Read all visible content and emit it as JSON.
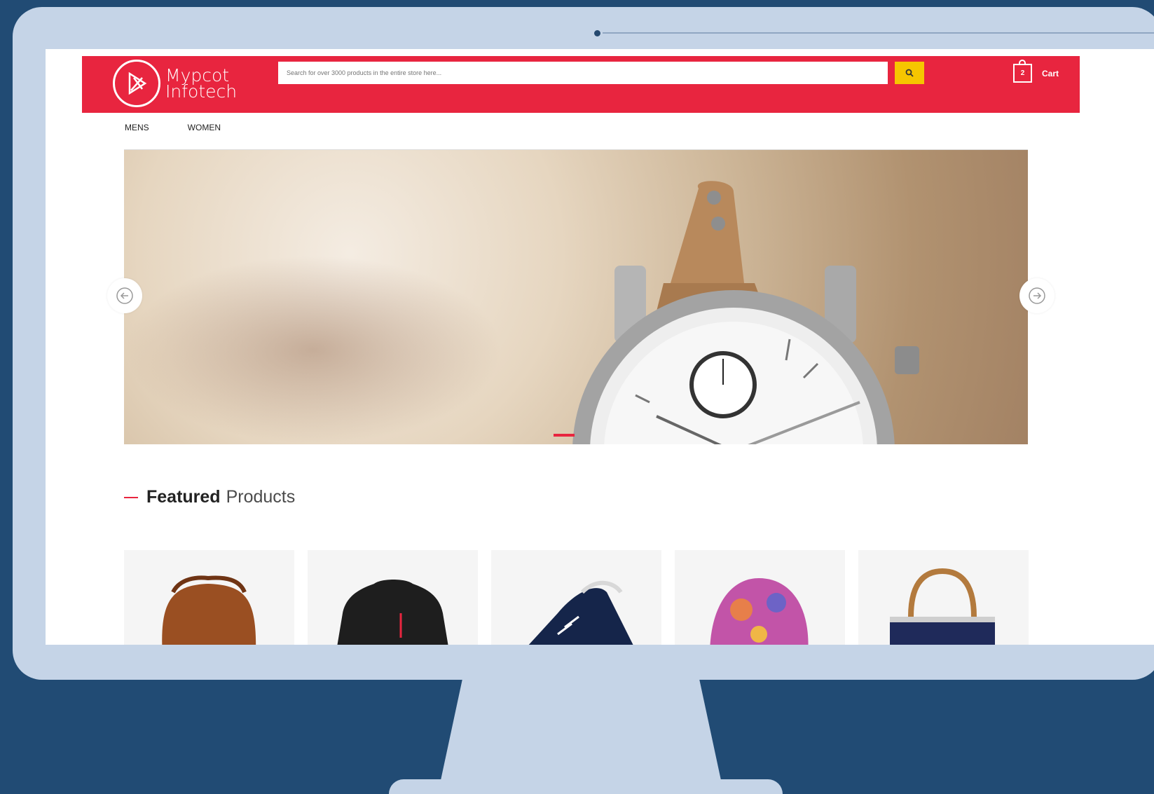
{
  "brand": {
    "line1": "Mypcot",
    "line2": "Infotech"
  },
  "header": {
    "search_placeholder": "Search for over 3000 products in the entire store here...",
    "cart_count": "2",
    "cart_label": "Cart"
  },
  "nav": {
    "items": [
      "MENS",
      "WOMEN"
    ]
  },
  "featured": {
    "bold": "Featured",
    "rest": "Products"
  },
  "products": [
    {
      "name": "backpack"
    },
    {
      "name": "jacket"
    },
    {
      "name": "sneaker"
    },
    {
      "name": "scarf"
    },
    {
      "name": "tote-bag"
    }
  ],
  "colors": {
    "brand_red": "#e8253f",
    "search_yellow": "#f6c600",
    "monitor": "#c5d4e7",
    "background": "#214b74"
  },
  "icons": {
    "search": "search-icon",
    "cart": "shopping-bag-icon",
    "prev": "arrow-left-icon",
    "next": "arrow-right-icon"
  }
}
